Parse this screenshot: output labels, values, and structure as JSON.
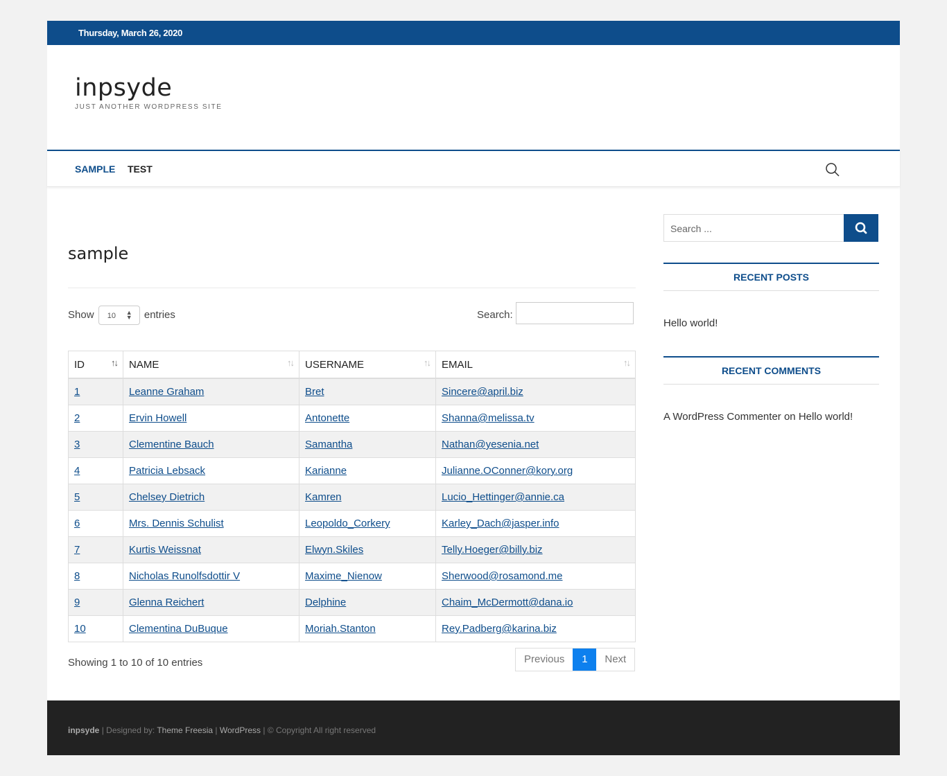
{
  "topbar": {
    "date": "Thursday, March 26, 2020"
  },
  "site": {
    "title": "inpsyde",
    "tagline": "JUST ANOTHER WORDPRESS SITE"
  },
  "nav": {
    "items": [
      {
        "label": "SAMPLE"
      },
      {
        "label": "TEST"
      }
    ]
  },
  "main": {
    "title": "sample",
    "length": {
      "show": "Show",
      "value": "10",
      "entries": "entries"
    },
    "search_label": "Search:",
    "columns": [
      "ID",
      "NAME",
      "USERNAME",
      "EMAIL"
    ],
    "rows": [
      [
        "1",
        "Leanne Graham",
        "Bret",
        "Sincere@april.biz"
      ],
      [
        "2",
        "Ervin Howell",
        "Antonette",
        "Shanna@melissa.tv"
      ],
      [
        "3",
        "Clementine Bauch",
        "Samantha",
        "Nathan@yesenia.net"
      ],
      [
        "4",
        "Patricia Lebsack",
        "Karianne",
        "Julianne.OConner@kory.org"
      ],
      [
        "5",
        "Chelsey Dietrich",
        "Kamren",
        "Lucio_Hettinger@annie.ca"
      ],
      [
        "6",
        "Mrs. Dennis Schulist",
        "Leopoldo_Corkery",
        "Karley_Dach@jasper.info"
      ],
      [
        "7",
        "Kurtis Weissnat",
        "Elwyn.Skiles",
        "Telly.Hoeger@billy.biz"
      ],
      [
        "8",
        "Nicholas Runolfsdottir V",
        "Maxime_Nienow",
        "Sherwood@rosamond.me"
      ],
      [
        "9",
        "Glenna Reichert",
        "Delphine",
        "Chaim_McDermott@dana.io"
      ],
      [
        "10",
        "Clementina DuBuque",
        "Moriah.Stanton",
        "Rey.Padberg@karina.biz"
      ]
    ],
    "info": "Showing 1 to 10 of 10 entries",
    "pager": {
      "previous": "Previous",
      "current": "1",
      "next": "Next"
    }
  },
  "sidebar": {
    "search_placeholder": "Search ...",
    "recent_posts_title": "RECENT POSTS",
    "recent_posts": [
      "Hello world!"
    ],
    "recent_comments_title": "RECENT COMMENTS",
    "comment": {
      "author": "A WordPress Commenter",
      "on": "on",
      "post": "Hello world!"
    }
  },
  "footer": {
    "brand": "inpsyde",
    "sep": "|",
    "designed_by": "Designed by:",
    "theme": "Theme Freesia",
    "wordpress": "WordPress",
    "copyright": "© Copyright All right reserved"
  },
  "colors": {
    "primary": "#0e4d8b",
    "page_bg": "#f2f2f2",
    "footer_bg": "#222222",
    "pager_active": "#0d80ee"
  }
}
